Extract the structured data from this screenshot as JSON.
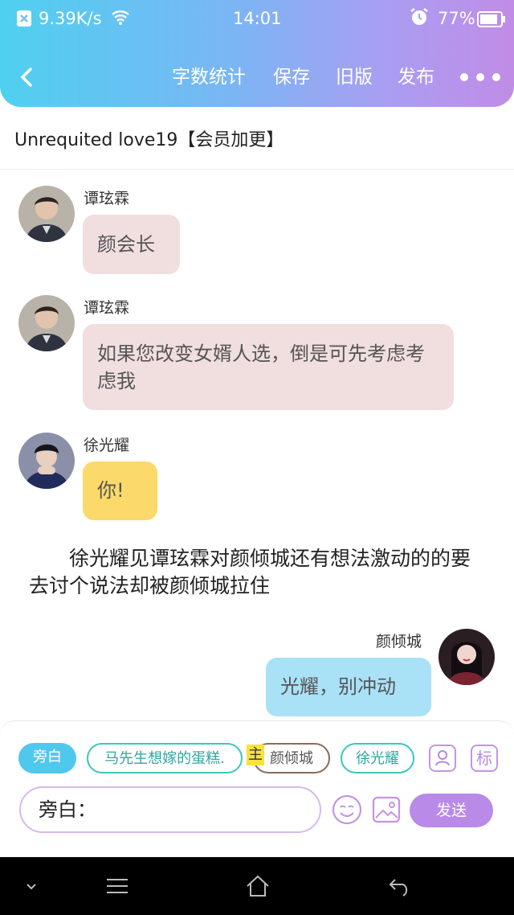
{
  "status_bar": {
    "speed": "9.39K/s",
    "time": "14:01",
    "battery": "77%"
  },
  "header": {
    "back_icon": "chevron-left-icon",
    "menu": [
      "字数统计",
      "保存",
      "旧版",
      "发布"
    ],
    "more_icon": "more-dots-icon"
  },
  "chapter_title": "Unrequited love19【会员加更】",
  "messages": [
    {
      "name": "谭玹霖",
      "text": "颜会长",
      "color": "#f1dede",
      "side": "left"
    },
    {
      "name": "谭玹霖",
      "text": "如果您改变女婿人选，倒是可先考虑考虑我",
      "color": "#f1dede",
      "side": "left"
    },
    {
      "name": "徐光耀",
      "text": "你!",
      "color": "#fbd96b",
      "side": "left"
    },
    {
      "name": "颜倾城",
      "text": "光耀，别冲动",
      "color": "#a9e1f7",
      "side": "right"
    }
  ],
  "narration": "徐光耀见谭玹霖对颜倾城还有想法激动的的要去讨个说法却被颜倾城拉住",
  "characters": {
    "narrator": "旁白",
    "c1": "马先生想嫁的蛋糕.",
    "lead_badge": "主",
    "c2": "颜倾城",
    "c3": "徐光耀"
  },
  "tools": {
    "role_icon": "character-icon",
    "tag_label": "标"
  },
  "input": {
    "text": "旁白："
  },
  "actions": {
    "emoji_icon": "emoji-icon",
    "image_icon": "image-icon",
    "send": "发送"
  },
  "colors": {
    "accent": "#b98ae8",
    "teal": "#3cc6bd"
  }
}
